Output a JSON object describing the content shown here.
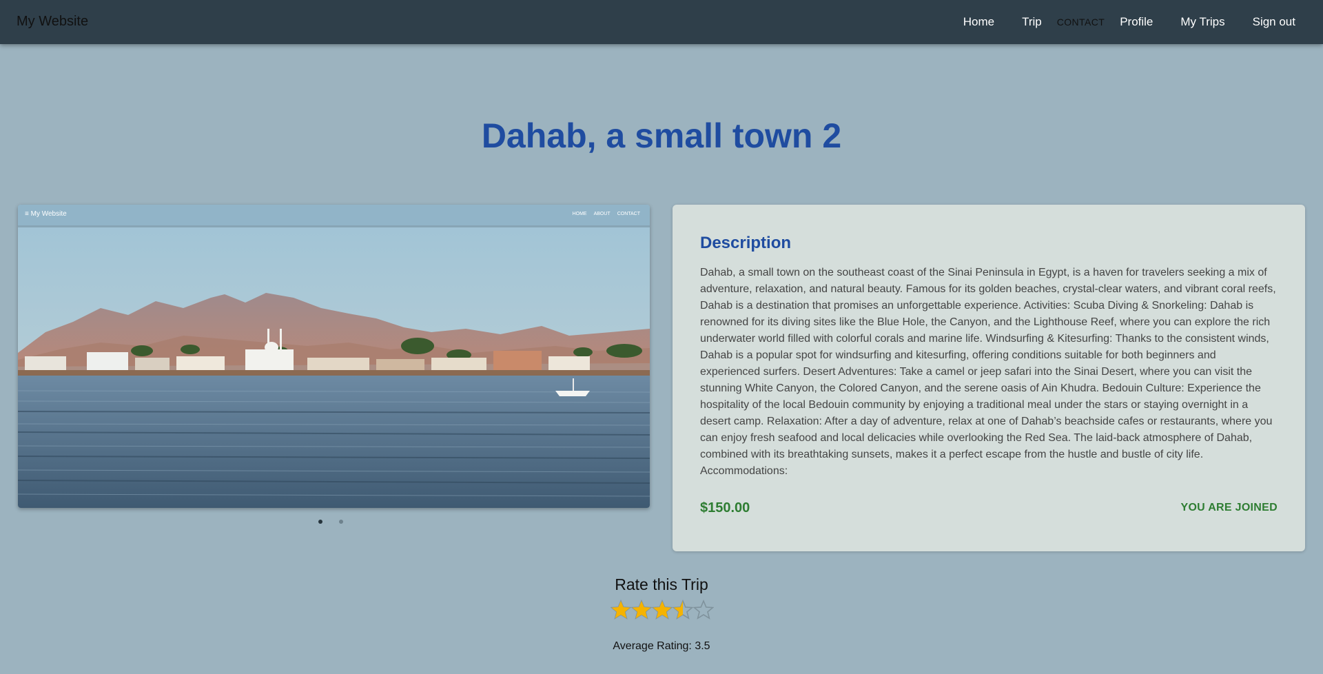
{
  "navbar": {
    "brand": "My Website",
    "links": [
      "Home",
      "Trip",
      "CONTACT",
      "Profile",
      "My Trips",
      "Sign out"
    ]
  },
  "page": {
    "title": "Dahab, a small town 2"
  },
  "carousel": {
    "image_nav": {
      "brand": "My Website",
      "links": [
        "HOME",
        "ABOUT",
        "CONTACT"
      ]
    },
    "slide_count": 2,
    "active_slide": 1
  },
  "card": {
    "heading": "Description",
    "description": "Dahab, a small town on the southeast coast of the Sinai Peninsula in Egypt, is a haven for travelers seeking a mix of adventure, relaxation, and natural beauty. Famous for its golden beaches, crystal-clear waters, and vibrant coral reefs, Dahab is a destination that promises an unforgettable experience. Activities: Scuba Diving & Snorkeling: Dahab is renowned for its diving sites like the Blue Hole, the Canyon, and the Lighthouse Reef, where you can explore the rich underwater world filled with colorful corals and marine life. Windsurfing & Kitesurfing: Thanks to the consistent winds, Dahab is a popular spot for windsurfing and kitesurfing, offering conditions suitable for both beginners and experienced surfers. Desert Adventures: Take a camel or jeep safari into the Sinai Desert, where you can visit the stunning White Canyon, the Colored Canyon, and the serene oasis of Ain Khudra. Bedouin Culture: Experience the hospitality of the local Bedouin community by enjoying a traditional meal under the stars or staying overnight in a desert camp. Relaxation: After a day of adventure, relax at one of Dahab’s beachside cafes or restaurants, where you can enjoy fresh seafood and local delicacies while overlooking the Red Sea. The laid-back atmosphere of Dahab, combined with its breathtaking sunsets, makes it a perfect escape from the hustle and bustle of city life. Accommodations:",
    "price": "$150.00",
    "status": "YOU ARE JOINED"
  },
  "rating": {
    "title": "Rate this Trip",
    "value": 3.5,
    "max": 5,
    "average_label": "Average Rating: 3.5"
  },
  "colors": {
    "background": "#9cb3bf",
    "navbar": "#2f3f4a",
    "title": "#1f4ca0",
    "price": "#2e7d32",
    "star_filled": "#f5b301",
    "star_empty": "#7f929c"
  },
  "icons": {
    "star_filled": "star-filled-icon",
    "star_half": "star-half-icon",
    "star_empty": "star-empty-icon"
  }
}
